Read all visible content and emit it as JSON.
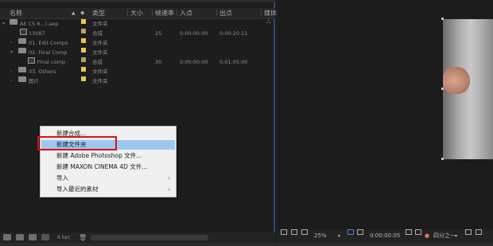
{
  "columns": {
    "name": "名称",
    "type": "类型",
    "size": "大小",
    "fps": "帧速率",
    "in": "入点",
    "out": "出点",
    "media": "媒体"
  },
  "rows": [
    {
      "name": "AE CS 6...).aep",
      "expanded": true,
      "icon": "folder-icon",
      "color": "#e6c84a",
      "type": "文件夹",
      "fps": "",
      "in": "",
      "out": ""
    },
    {
      "name": "13087",
      "icon": "composition-icon",
      "color": "#b9a06a",
      "type": "合成",
      "fps": "25",
      "in": "0:00:00:00",
      "out": "0:00:20:11"
    },
    {
      "name": "01. Edit Comps",
      "icon": "folder-icon",
      "color": "#e6c84a",
      "type": "文件夹",
      "fps": "",
      "in": "",
      "out": ""
    },
    {
      "name": "02. Final Comp",
      "expanded": true,
      "icon": "folder-icon",
      "color": "#e6c84a",
      "type": "文件夹",
      "fps": "",
      "in": "",
      "out": ""
    },
    {
      "name": "Final comp",
      "icon": "composition-icon",
      "color": "#b9a06a",
      "type": "合成",
      "fps": "30",
      "in": "0:00:00:00",
      "out": "0:01:05:00"
    },
    {
      "name": "03. Others",
      "icon": "folder-icon",
      "color": "#e6c84a",
      "type": "文件夹",
      "fps": "",
      "in": "",
      "out": ""
    },
    {
      "name": "图片",
      "icon": "folder-icon",
      "color": "#e6c84a",
      "type": "文件夹",
      "fps": "",
      "in": "",
      "out": ""
    }
  ],
  "context_menu": {
    "items": [
      {
        "label": "新建合成...",
        "submenu": false
      },
      {
        "label": "新建文件夹",
        "submenu": false,
        "highlighted": true
      },
      {
        "label": "新建 Adobe Photoshop 文件...",
        "submenu": false
      },
      {
        "label": "新建 MAXON CINEMA 4D 文件...",
        "submenu": false
      },
      {
        "label": "导入",
        "submenu": true
      },
      {
        "label": "导入最近的素材",
        "submenu": true
      }
    ],
    "submenu_glyph": "›"
  },
  "footer": {
    "bpc": "8 bpc"
  },
  "viewer": {
    "zoom": "25%",
    "timecode": "0:00:00:05",
    "resolution": "四分之一"
  }
}
